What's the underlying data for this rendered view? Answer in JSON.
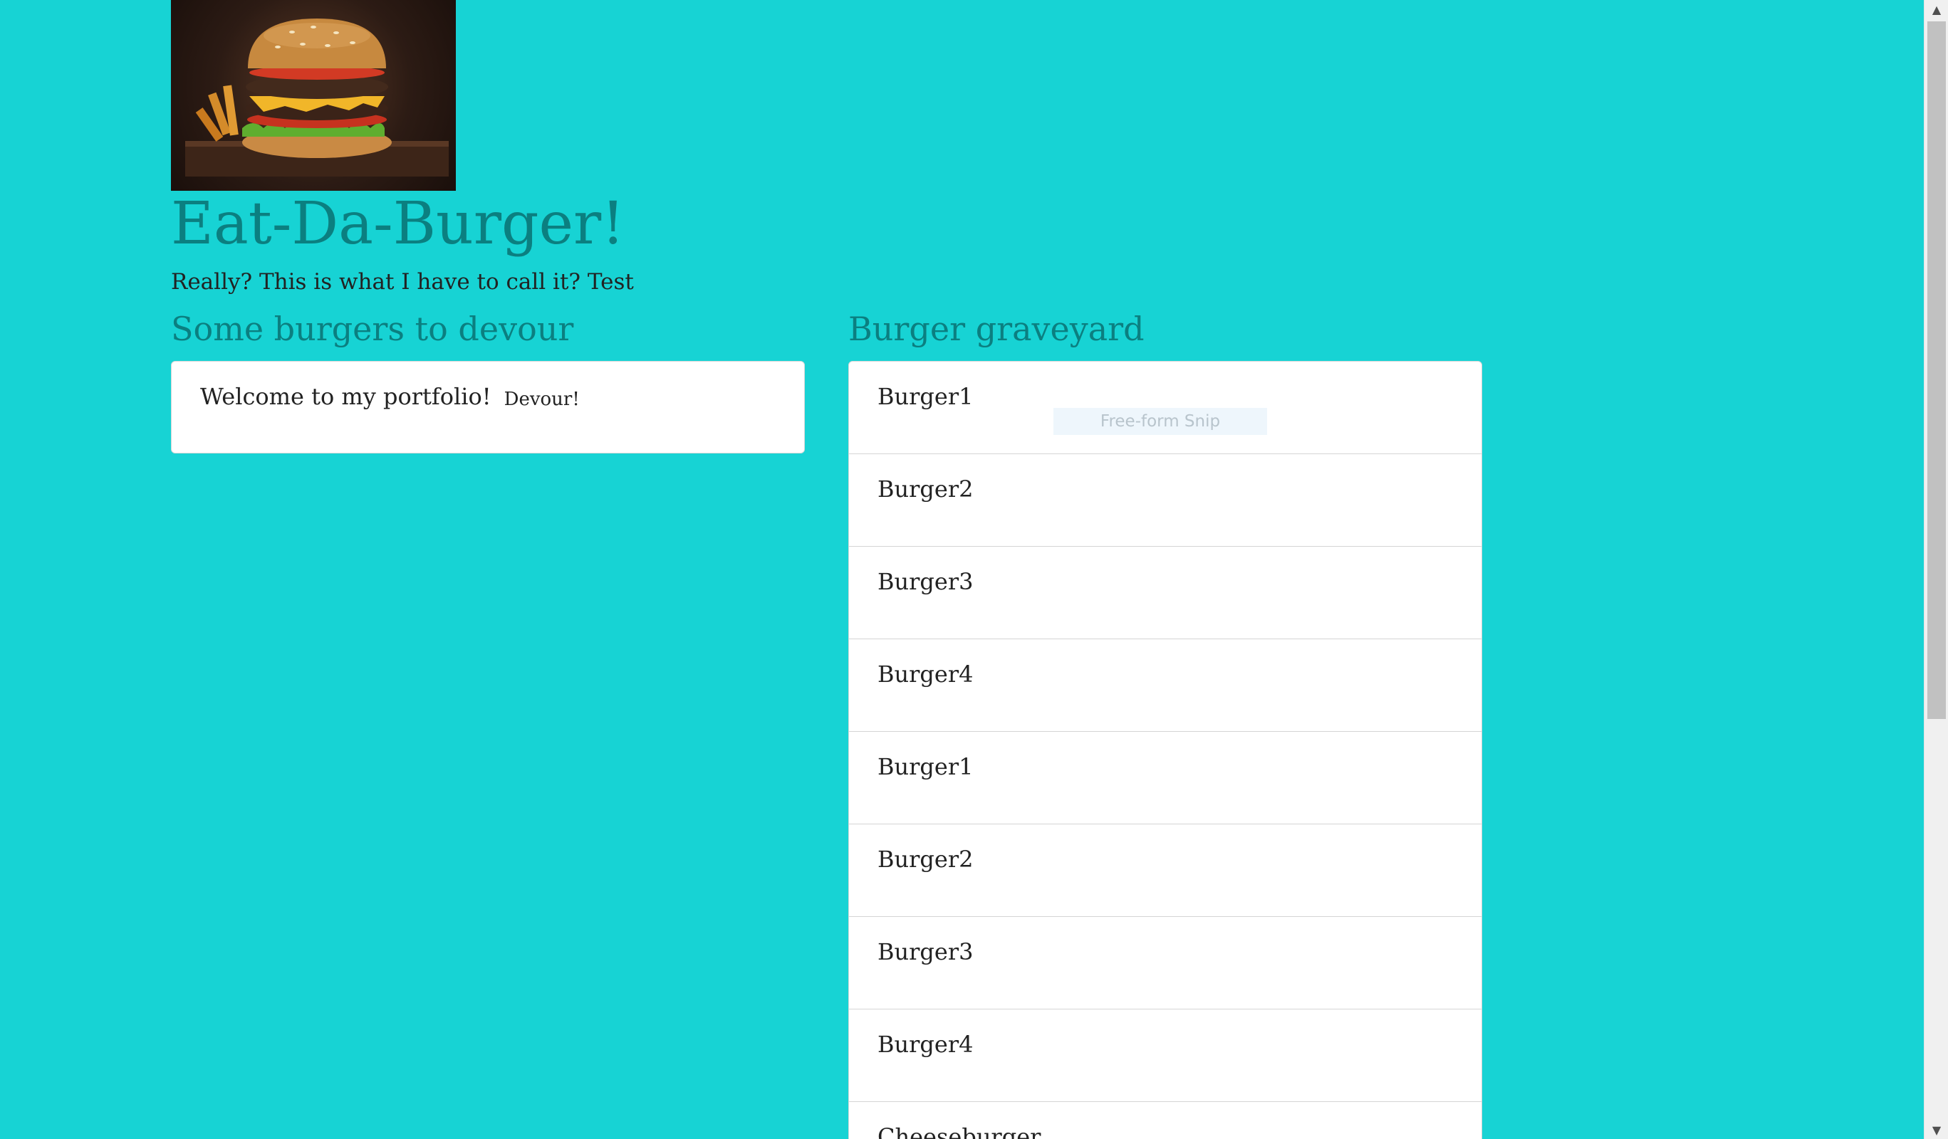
{
  "header": {
    "title": "Eat-Da-Burger!",
    "subtitle": "Really? This is what I have to call it? Test"
  },
  "devour_section": {
    "heading": "Some burgers to devour",
    "items": [
      {
        "name": "Welcome to my portfolio!",
        "button_label": "Devour!"
      }
    ]
  },
  "graveyard_section": {
    "heading": "Burger graveyard",
    "items": [
      "Burger1",
      "Burger2",
      "Burger3",
      "Burger4",
      "Burger1",
      "Burger2",
      "Burger3",
      "Burger4",
      "Cheeseburger"
    ]
  },
  "overlay": {
    "snip_label": "Free-form Snip"
  },
  "colors": {
    "background": "#17d3d4",
    "heading": "#0b7f80"
  },
  "icons": {
    "scroll_up": "chevron-up-icon",
    "scroll_down": "chevron-down-icon"
  }
}
